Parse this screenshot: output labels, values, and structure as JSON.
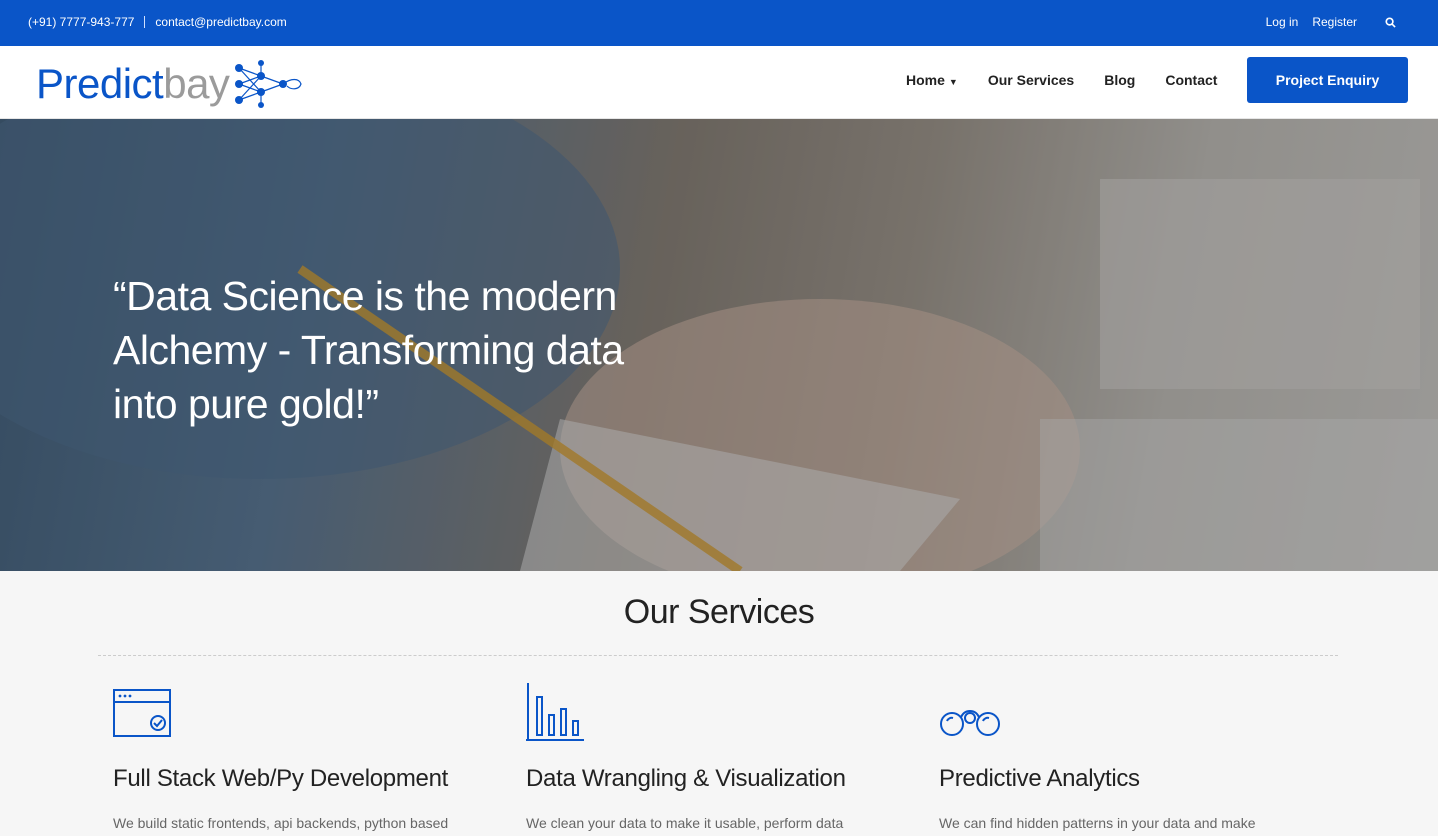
{
  "topbar": {
    "phone": "(+91) 7777-943-777",
    "email": "contact@predictbay.com",
    "login": "Log in",
    "register": "Register",
    "search_icon": "search-icon"
  },
  "header": {
    "logo_part1": "Predict",
    "logo_part2": "bay",
    "nav": {
      "home": "Home",
      "services": "Our Services",
      "blog": "Blog",
      "contact": "Contact"
    },
    "cta": "Project Enquiry"
  },
  "hero": {
    "quote": "“Data Science is the modern Alchemy - Transforming data into pure gold!”"
  },
  "services": {
    "title": "Our Services",
    "items": [
      {
        "icon": "browser-window-icon",
        "title": "Full Stack Web/Py Development",
        "text": "We build static frontends, api backends, python based"
      },
      {
        "icon": "bar-chart-icon",
        "title": "Data Wrangling & Visualization",
        "text": "We clean your data to make it usable, perform data"
      },
      {
        "icon": "binoculars-icon",
        "title": "Predictive Analytics",
        "text": "We can find hidden patterns in your data and make"
      }
    ]
  },
  "colors": {
    "brand": "#0a55c8",
    "logo_gray": "#9b9b9b"
  }
}
